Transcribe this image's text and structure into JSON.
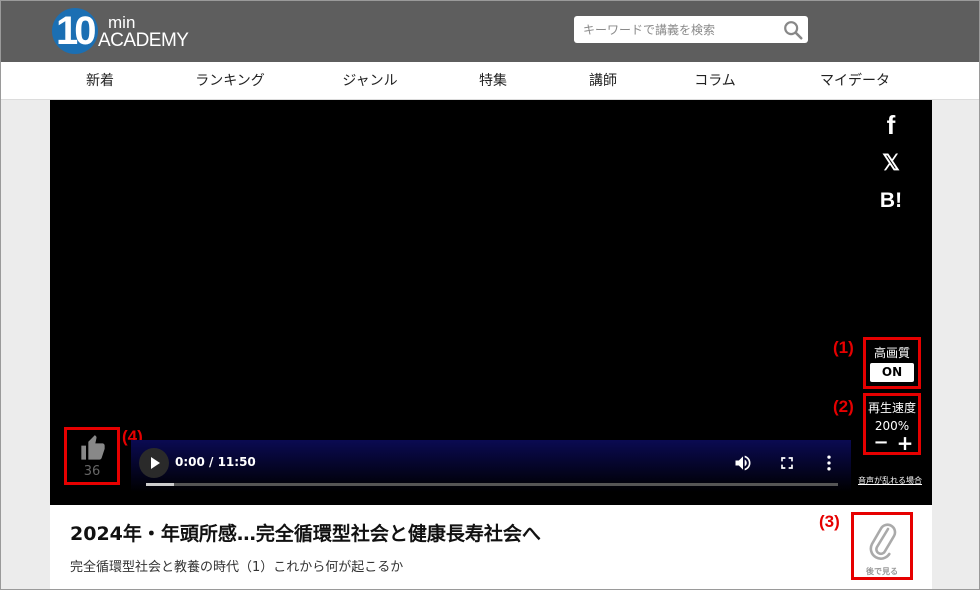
{
  "header": {
    "logo": {
      "number": "10",
      "small": "min",
      "word": "ACADEMY"
    },
    "search": {
      "placeholder": "キーワードで講義を検索",
      "value": ""
    }
  },
  "nav": {
    "items": [
      {
        "label": "新着"
      },
      {
        "label": "ランキング"
      },
      {
        "label": "ジャンル"
      },
      {
        "label": "特集"
      },
      {
        "label": "講師"
      },
      {
        "label": "コラム"
      },
      {
        "label": "マイデータ"
      }
    ]
  },
  "player": {
    "share": {
      "facebook": "f",
      "x": "𝕏",
      "hatena": "B!"
    },
    "quality": {
      "label": "高画質",
      "state": "ON"
    },
    "speed": {
      "label": "再生速度",
      "value": "200%",
      "minus": "−",
      "plus": "+"
    },
    "likes": {
      "count": "36"
    },
    "time": "0:00 / 11:50",
    "progress_fraction": 0.04,
    "audio_link": "音声が乱れる場合"
  },
  "annotations": {
    "a1": "(1)",
    "a2": "(2)",
    "a3": "(3)",
    "a4": "(4)"
  },
  "lecture": {
    "title": "2024年・年頭所感…完全循環型社会と健康長寿社会へ",
    "subtitle": "完全循環型社会と教養の時代（1）これから何が起こるか",
    "watch_later": "後で見る"
  },
  "colors": {
    "header_bg": "#5e5e5e",
    "logo_blue": "#1b6fb3",
    "annotation_red": "#e60000",
    "controls_blue": "#0a0a52"
  }
}
